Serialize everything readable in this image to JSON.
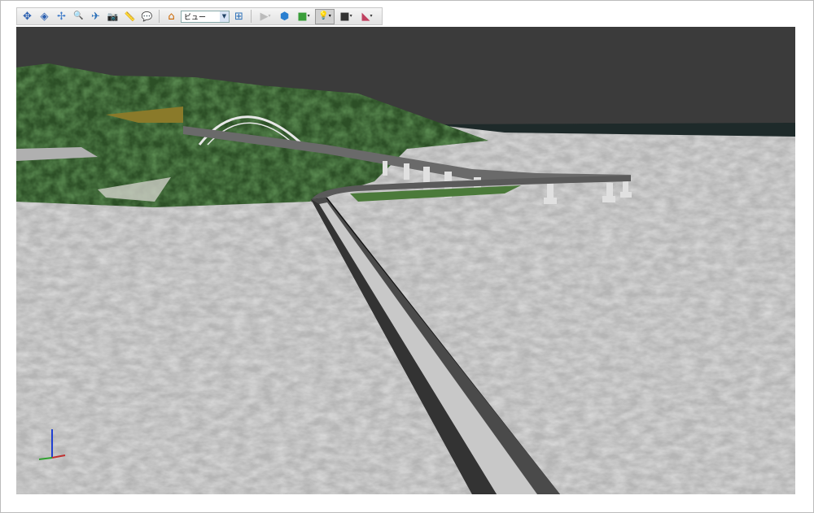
{
  "toolbar": {
    "tools": [
      {
        "icon": "pan-icon",
        "glyph": "✥",
        "color": "#2a5fb0"
      },
      {
        "icon": "orbit-icon",
        "glyph": "◈",
        "color": "#2a5fb0"
      },
      {
        "icon": "free-orbit-icon",
        "glyph": "✢",
        "color": "#3a78c8"
      },
      {
        "icon": "zoom-icon",
        "glyph": "🔍",
        "color": "#446"
      },
      {
        "icon": "fly-icon",
        "glyph": "✈",
        "color": "#2a6fb8"
      },
      {
        "icon": "camera-icon",
        "glyph": "📷",
        "color": "#c90"
      },
      {
        "icon": "measure-icon",
        "glyph": "📏",
        "color": "#e0b000"
      },
      {
        "icon": "comment-icon",
        "glyph": "💬",
        "color": "#e0a000"
      }
    ],
    "home_icon": "home-icon",
    "view_select": {
      "value": "ビュー"
    },
    "tree_icon": "model-tree-icon",
    "right_tools": [
      {
        "icon": "play-icon",
        "glyph": "▶",
        "color": "#bbb",
        "dropdown": true
      },
      {
        "icon": "render-cube-icon",
        "glyph": "⬢",
        "color": "#2a7fd0",
        "dropdown": false
      },
      {
        "icon": "cube-group-icon",
        "glyph": "■",
        "color": "#3a9e3a",
        "dropdown": true
      },
      {
        "icon": "lighting-icon",
        "glyph": "💡",
        "color": "#777",
        "dropdown": true,
        "active": true
      },
      {
        "icon": "background-color-icon",
        "glyph": "■",
        "color": "#333",
        "dropdown": true
      },
      {
        "icon": "section-icon",
        "glyph": "◣",
        "color": "#c04060",
        "dropdown": true
      }
    ]
  },
  "viewport": {
    "sky_color": "#3b3b3b",
    "water_color": "#b9b9b9",
    "terrain_color": "#2f5a2c"
  }
}
